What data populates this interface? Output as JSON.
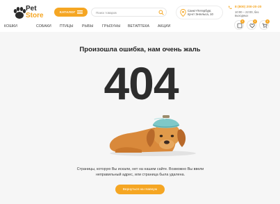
{
  "header": {
    "logo": {
      "line1": "Pet",
      "line2": "Store"
    },
    "catalog_label": "КАТАЛОГ",
    "search": {
      "placeholder": "Поиск товаров",
      "value": ""
    },
    "location": {
      "line1": "Санкт-Петербург,",
      "line2": "пр-кт Энгельса, 10"
    },
    "contacts": {
      "phone": "8 (800) 200-20-20",
      "hours_line1": "10:00 – 22:00, без",
      "hours_line2": "выходных"
    }
  },
  "nav": {
    "items": [
      "КОШКИ",
      "СОБАКИ",
      "ПТИЦЫ",
      "РЫБЫ",
      "ГРЫЗУНЫ",
      "ВЕТАПТЕКА",
      "АКЦИИ"
    ],
    "icon_badges": {
      "compare": "0",
      "favorites": "0",
      "cart": "0"
    }
  },
  "error": {
    "title": "Произошла ошибка, нам очень жаль",
    "code": "404",
    "description_line1": "Страницы, которую Вы искали, нет на нашем сайте. Возможно Вы ввели",
    "description_line2": "неправильный адрес, или страница была удалена.",
    "home_button": "Вернуться на главную"
  },
  "colors": {
    "accent": "#f5a623",
    "background": "#f6f6f6",
    "text": "#2d2d2d"
  }
}
